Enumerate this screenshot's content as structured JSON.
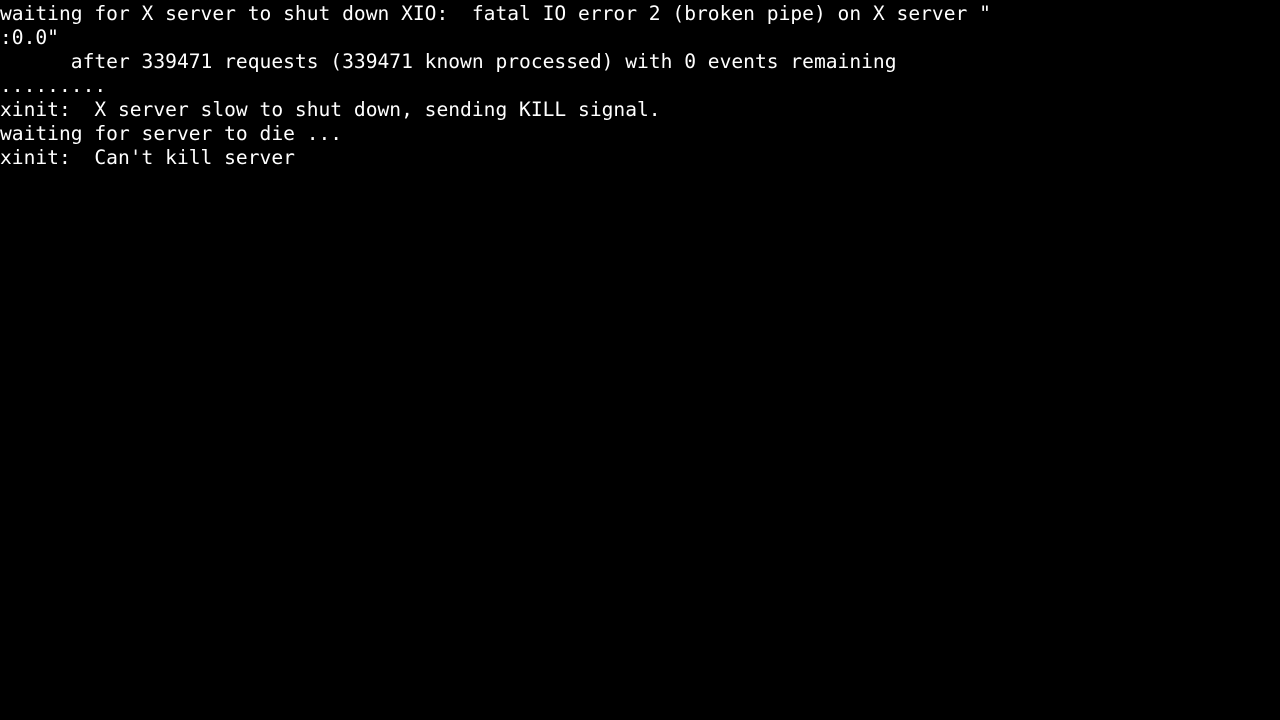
{
  "screen": {
    "kind": "tty-console",
    "background_color": "#000000",
    "foreground_color": "#ffffff",
    "columns": 83,
    "rows": 30
  },
  "console": {
    "lines": [
      "waiting for X server to shut down XIO:  fatal IO error 2 (broken pipe) on X server \"",
      ":0.0\"",
      "      after 339471 requests (339471 known processed) with 0 events remaining",
      ".........",
      "xinit:  X server slow to shut down, sending KILL signal.",
      "waiting for server to die ...",
      "xinit:  Can't kill server"
    ],
    "line_labels": [
      "waiting-for-x-server-shutdown",
      "x-display-name",
      "xio-request-count",
      "progress-dots",
      "xinit-kill-signal",
      "waiting-for-server-to-die",
      "xinit-cant-kill-server"
    ],
    "details": {
      "xio_error_code": "2",
      "xio_error_text": "broken pipe",
      "x_display": ":0.0",
      "requests": "339471",
      "known_processed": "339471",
      "events_remaining": "0",
      "signal": "KILL",
      "dot_count": "9"
    }
  }
}
